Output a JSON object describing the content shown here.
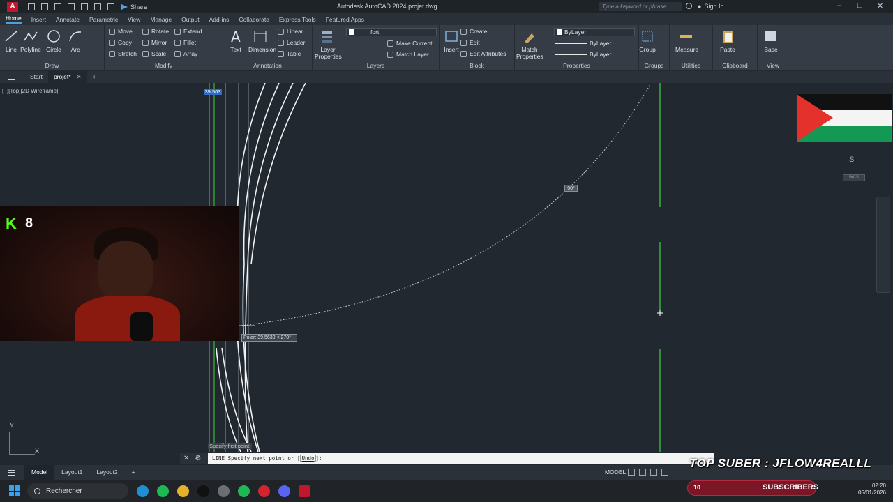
{
  "window": {
    "app_logo": "A",
    "title": "Autodesk AutoCAD 2024   projet.dwg",
    "share_label": "Share",
    "search_placeholder": "Type a keyword or phrase",
    "signin_label": "Sign In"
  },
  "ribbon_tabs": [
    "Home",
    "Insert",
    "Annotate",
    "Parametric",
    "View",
    "Manage",
    "Output",
    "Add-ins",
    "Collaborate",
    "Express Tools",
    "Featured Apps"
  ],
  "ribbon": {
    "draw": {
      "title": "Draw",
      "buttons": [
        "Line",
        "Polyline",
        "Circle",
        "Arc"
      ]
    },
    "modify": {
      "title": "Modify",
      "col1": [
        "Move",
        "Copy",
        "Stretch"
      ],
      "col2": [
        "Rotate",
        "Mirror",
        "Scale"
      ],
      "col3": [
        "Extend",
        "Fillet",
        "Array"
      ]
    },
    "annotation": {
      "title": "Annotation",
      "buttons": [
        "Text",
        "Dimension"
      ],
      "small": [
        "Linear",
        "Leader",
        "Table"
      ]
    },
    "layers": {
      "title": "Layers",
      "properties_label": "Layer Properties",
      "current_layer": "fort",
      "small": [
        "Make Current",
        "Match Layer"
      ]
    },
    "block": {
      "title": "Block",
      "insert_label": "Insert",
      "small": [
        "Create",
        "Edit",
        "Edit Attributes"
      ]
    },
    "properties": {
      "title": "Properties",
      "match_label": "Match Properties",
      "color": "ByLayer",
      "linetype": "ByLayer",
      "lineweight": "ByLayer"
    },
    "groups": {
      "title": "Groups",
      "group_label": "Group"
    },
    "utilities": {
      "title": "Utilities",
      "measure_label": "Measure"
    },
    "clipboard": {
      "title": "Clipboard",
      "paste_label": "Paste"
    },
    "view": {
      "title": "View",
      "base_label": "Base"
    }
  },
  "file_tabs": {
    "start": "Start",
    "active": "projet*"
  },
  "canvas": {
    "viewport_label": "[−][Top][2D Wireframe]",
    "dynamic_input": "39.563",
    "angle_tooltip": "90°",
    "polar_tooltip": "Polar: 39.5630 < 270°",
    "specify_tooltip": "Specify first point:",
    "compass_dir": "S",
    "wcs_label": "WCS",
    "ucs_y": "Y",
    "ucs_x": "X"
  },
  "webcam": {
    "kick_count": "8"
  },
  "command_line": {
    "prefix": "LINE Specify next point or [",
    "option": "Undo",
    "suffix": "]:"
  },
  "layout_tabs": [
    "Model",
    "Layout1",
    "Layout2"
  ],
  "status": {
    "space": "MODEL"
  },
  "overlay": {
    "top_suber": "TOP SUBER : JFLOW4REALLL",
    "subs_count": "10",
    "subs_label": "SUBSCRIBERS"
  },
  "taskbar": {
    "search_label": "Rechercher",
    "time": "02:20",
    "date": "05/01/2026"
  },
  "colors": {
    "accent": "#4aa3e0",
    "green_line": "#3fd23f",
    "canvas": "#212830"
  }
}
